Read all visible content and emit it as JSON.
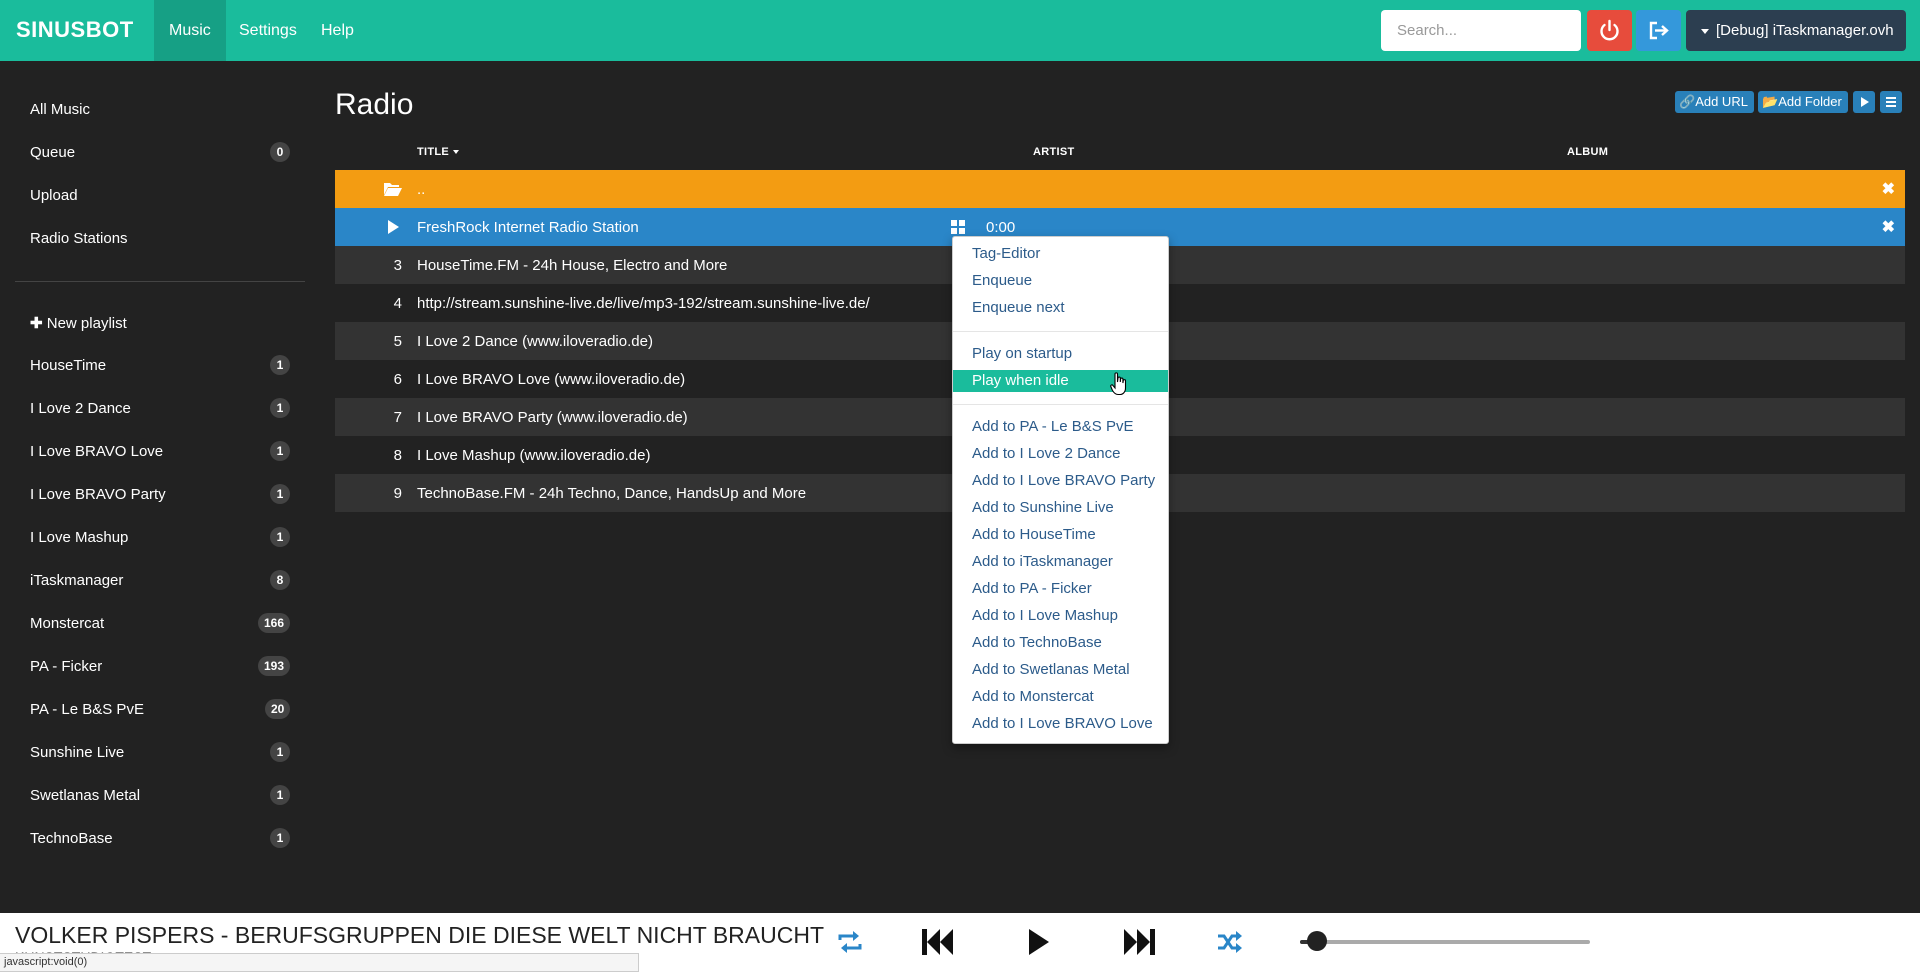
{
  "brand": "SINUSBOT",
  "nav": {
    "items": [
      "Music",
      "Settings",
      "Help"
    ],
    "active": "Music"
  },
  "header": {
    "search_placeholder": "Search...",
    "instance_label": "[Debug] iTaskmanager.ovh"
  },
  "sidebar": {
    "main": [
      {
        "label": "All Music"
      },
      {
        "label": "Queue",
        "count": "0"
      },
      {
        "label": "Upload"
      },
      {
        "label": "Radio Stations"
      }
    ],
    "new_playlist_label": "New playlist",
    "playlists": [
      {
        "label": "HouseTime",
        "count": "1"
      },
      {
        "label": "I Love 2 Dance",
        "count": "1"
      },
      {
        "label": "I Love BRAVO Love",
        "count": "1"
      },
      {
        "label": "I Love BRAVO Party",
        "count": "1"
      },
      {
        "label": "I Love Mashup",
        "count": "1"
      },
      {
        "label": "iTaskmanager",
        "count": "8"
      },
      {
        "label": "Monstercat",
        "count": "166"
      },
      {
        "label": "PA - Ficker",
        "count": "193"
      },
      {
        "label": "PA - Le B&S PvE",
        "count": "20"
      },
      {
        "label": "Sunshine Live",
        "count": "1"
      },
      {
        "label": "Swetlanas Metal",
        "count": "1"
      },
      {
        "label": "TechnoBase",
        "count": "1"
      }
    ]
  },
  "main": {
    "title": "Radio",
    "toolbar": {
      "add_url": "Add URL",
      "add_folder": "Add Folder"
    },
    "columns": {
      "title": "TITLE",
      "artist": "ARTIST",
      "album": "ALBUM"
    },
    "parent_row": "..",
    "rows": [
      {
        "num": "",
        "title": "FreshRock Internet Radio Station",
        "time": "0:00",
        "selected": true
      },
      {
        "num": "3",
        "title": "HouseTime.FM - 24h House, Electro and More"
      },
      {
        "num": "4",
        "title": "http://stream.sunshine-live.de/live/mp3-192/stream.sunshine-live.de/"
      },
      {
        "num": "5",
        "title": "I Love 2 Dance (www.iloveradio.de)"
      },
      {
        "num": "6",
        "title": "I Love BRAVO Love (www.iloveradio.de)"
      },
      {
        "num": "7",
        "title": "I Love BRAVO Party (www.iloveradio.de)"
      },
      {
        "num": "8",
        "title": "I Love Mashup (www.iloveradio.de)"
      },
      {
        "num": "9",
        "title": "TechnoBase.FM - 24h Techno, Dance, HandsUp and More"
      }
    ]
  },
  "context_menu": {
    "group1": [
      "Tag-Editor",
      "Enqueue",
      "Enqueue next"
    ],
    "group2": [
      "Play on startup",
      "Play when idle"
    ],
    "highlighted": "Play when idle",
    "group3": [
      "Add to PA - Le B&S PvE",
      "Add to I Love 2 Dance",
      "Add to I Love BRAVO Party",
      "Add to Sunshine Live",
      "Add to HouseTime",
      "Add to iTaskmanager",
      "Add to PA - Ficker",
      "Add to I Love Mashup",
      "Add to TechnoBase",
      "Add to Swetlanas Metal",
      "Add to Monstercat",
      "Add to I Love BRAVO Love"
    ]
  },
  "player": {
    "now_playing_title": "VOLKER PISPERS - BERUFSGRUPPEN DIE DIESE WELT NICHT BRAUCHT",
    "now_playing_artist": "KUNSTSTUDIOTEST",
    "volume_fraction": 0.06,
    "status_text": "javascript:void(0)"
  },
  "colors": {
    "accent": "#1abc9c",
    "danger": "#e74c3c",
    "primary": "#3498db",
    "folder_row": "#f39c12",
    "selected_row": "#2a86c8"
  }
}
